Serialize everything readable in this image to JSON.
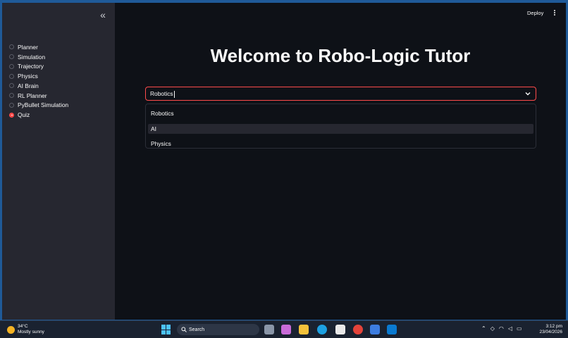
{
  "sidebar": {
    "collapse_glyph": "«",
    "options": [
      {
        "label": "Planner",
        "selected": false
      },
      {
        "label": "Simulation",
        "selected": false
      },
      {
        "label": "Trajectory",
        "selected": false
      },
      {
        "label": "Physics",
        "selected": false
      },
      {
        "label": "AI Brain",
        "selected": false
      },
      {
        "label": "RL Planner",
        "selected": false
      },
      {
        "label": "PyBullet Simulation",
        "selected": false
      },
      {
        "label": "Quiz",
        "selected": true
      }
    ]
  },
  "header": {
    "deploy_label": "Deploy"
  },
  "main": {
    "title": "Welcome to Robo-Logic Tutor",
    "select": {
      "value": "Robotics"
    },
    "dropdown_options": [
      "Robotics",
      "AI",
      "Physics"
    ],
    "highlighted_option": "AI"
  },
  "taskbar": {
    "weather_temp": "34°C",
    "weather_desc": "Mostly sunny",
    "search_label": "Search",
    "time": "3:12 pm",
    "date": "23/04/2026"
  },
  "colors": {
    "accent": "#ff4b4b",
    "background": "#0e1117",
    "sidebar": "#262730"
  }
}
